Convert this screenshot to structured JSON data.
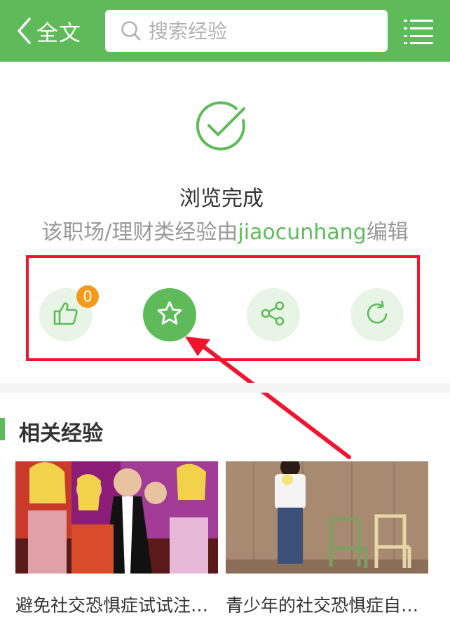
{
  "header": {
    "back_label": "全文",
    "search_placeholder": "搜索经验",
    "accent_color": "#5fbb5a"
  },
  "finish": {
    "title": "浏览完成",
    "subtitle_prefix": "该职场/理财类经验由",
    "author": "jiaocunhang",
    "subtitle_suffix": "编辑"
  },
  "actions": [
    {
      "name": "like",
      "icon": "thumbs-up-icon",
      "count": "0"
    },
    {
      "name": "favorite",
      "icon": "star-icon"
    },
    {
      "name": "share",
      "icon": "share-icon"
    },
    {
      "name": "refresh",
      "icon": "refresh-icon"
    }
  ],
  "annotation": {
    "box_color": "#f0142f",
    "arrow_color": "#f0142f"
  },
  "related": {
    "heading": "相关经验",
    "items": [
      {
        "title": "避免社交恐惧症试试注意…",
        "image": "party-people-illustration"
      },
      {
        "title": "青少年的社交恐惧症自己…",
        "image": "girl-with-chairs-photo"
      }
    ]
  }
}
